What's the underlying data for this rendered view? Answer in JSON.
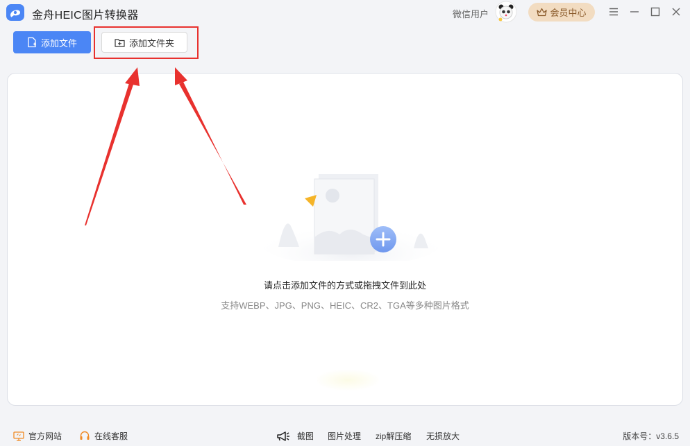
{
  "app": {
    "title": "金舟HEIC图片转换器",
    "user_name": "微信用户",
    "vip_label": "会员中心"
  },
  "toolbar": {
    "add_file_label": "添加文件",
    "add_folder_label": "添加文件夹"
  },
  "dropzone": {
    "main_text": "请点击添加文件的方式或拖拽文件到此处",
    "sub_text": "支持WEBP、JPG、PNG、HEIC、CR2、TGA等多种图片格式"
  },
  "footer": {
    "official_site": "官方网站",
    "online_service": "在线客服",
    "tools": [
      "截图",
      "图片处理",
      "zip解压缩",
      "无损放大"
    ],
    "version": "版本号：v3.6.5"
  },
  "colors": {
    "primary": "#4b86f5",
    "highlight": "#e8312e",
    "vip_bg": "#f2dcc1",
    "vip_text": "#8a5a2a"
  },
  "icons": [
    "app-logo-icon",
    "avatar-panda-icon",
    "crown-icon",
    "menu-icon",
    "minimize-icon",
    "maximize-icon",
    "close-icon",
    "file-add-icon",
    "folder-add-icon",
    "monitor-icon",
    "headset-icon",
    "megaphone-icon"
  ]
}
